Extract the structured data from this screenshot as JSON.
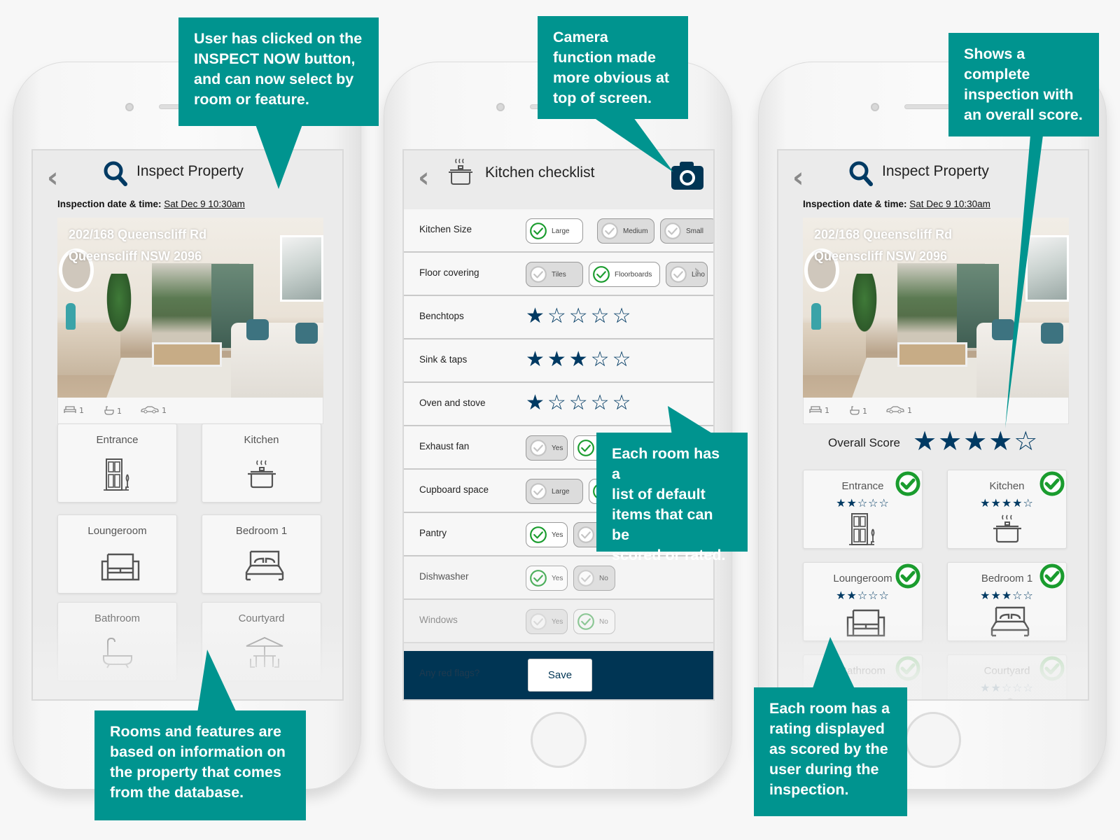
{
  "callouts": [
    "User has clicked on the\nINSPECT NOW button,\nand can now select by\nroom or feature.",
    "Camera\nfunction made\nmore obvious at\ntop of screen.",
    "Shows a\ncomplete\ninspection with\nan overall score.",
    "Each room has a\nlist of default\nitems that can be\nscored or rated.",
    "Rooms and features are\nbased on information on\nthe property that comes\nfrom the database.",
    "Each room has a\nrating displayed\nas scored by the\nuser during the\ninspection."
  ],
  "colors": {
    "callout": "#00948f",
    "navy": "#003a63",
    "footer": "#003554",
    "check_green": "#1a9c2e",
    "inspected_badge": "#17a23a"
  },
  "phone1": {
    "header": {
      "back_icon": "chevron-left-icon",
      "icon": "search-icon",
      "title": "Inspect Property"
    },
    "inspection": {
      "label": "Inspection date & time:",
      "value": "Sat Dec 9 10:30am"
    },
    "address": {
      "line1": "202/168 Queenscliff Rd",
      "line2": "Queenscliff NSW 2096"
    },
    "amenities": [
      {
        "icon": "bed-icon",
        "count": "1"
      },
      {
        "icon": "bath-icon",
        "count": "1"
      },
      {
        "icon": "car-icon",
        "count": "1"
      }
    ],
    "rooms": [
      {
        "name": "Entrance",
        "icon": "door"
      },
      {
        "name": "Kitchen",
        "icon": "pot"
      },
      {
        "name": "Loungeroom",
        "icon": "sofa"
      },
      {
        "name": "Bedroom 1",
        "icon": "bed"
      },
      {
        "name": "Bathroom",
        "icon": "bath"
      },
      {
        "name": "Courtyard",
        "icon": "umbrella"
      }
    ]
  },
  "phone2": {
    "header": {
      "back_icon": "chevron-left-icon",
      "icon": "pot-icon",
      "title": "Kitchen checklist",
      "camera_icon": "camera-icon"
    },
    "items": [
      {
        "label": "Kitchen Size",
        "type": "options",
        "options": [
          {
            "label": "Large",
            "selected": true
          },
          {
            "label": "Medium",
            "selected": false
          },
          {
            "label": "Small",
            "selected": false
          }
        ]
      },
      {
        "label": "Floor covering",
        "type": "options",
        "more": true,
        "options": [
          {
            "label": "Tiles",
            "selected": false
          },
          {
            "label": "Floorboards",
            "selected": true
          },
          {
            "label": "Lino",
            "selected": false
          }
        ]
      },
      {
        "label": "Benchtops",
        "type": "rating",
        "rating": 1
      },
      {
        "label": "Sink & taps",
        "type": "rating",
        "rating": 3
      },
      {
        "label": "Oven and stove",
        "type": "rating",
        "rating": 1
      },
      {
        "label": "Exhaust fan",
        "type": "options",
        "options": [
          {
            "label": "Yes",
            "selected": false
          },
          {
            "label": "",
            "selected": true
          }
        ]
      },
      {
        "label": "Cupboard space",
        "type": "options",
        "options": [
          {
            "label": "Large",
            "selected": false
          },
          {
            "label": "",
            "selected": true
          }
        ]
      },
      {
        "label": "Pantry",
        "type": "options",
        "options": [
          {
            "label": "Yes",
            "selected": true
          },
          {
            "label": "",
            "selected": false
          }
        ]
      },
      {
        "label": "Dishwasher",
        "type": "options",
        "options": [
          {
            "label": "Yes",
            "selected": true
          },
          {
            "label": "No",
            "selected": false
          }
        ]
      },
      {
        "label": "Windows",
        "type": "options",
        "options": [
          {
            "label": "Yes",
            "selected": false
          },
          {
            "label": "No",
            "selected": true
          }
        ]
      }
    ],
    "footer": {
      "red_flags": "Any red flags?",
      "save": "Save"
    }
  },
  "phone3": {
    "header": {
      "back_icon": "chevron-left-icon",
      "icon": "search-icon",
      "title": "Inspect Property"
    },
    "inspection": {
      "label": "Inspection date & time:",
      "value": "Sat Dec 9 10:30am"
    },
    "address": {
      "line1": "202/168 Queenscliff Rd",
      "line2": "Queenscliff NSW 2096"
    },
    "badge": "Inspected",
    "amenities": [
      {
        "icon": "bed-icon",
        "count": "1"
      },
      {
        "icon": "bath-icon",
        "count": "1"
      },
      {
        "icon": "car-icon",
        "count": "1"
      }
    ],
    "overall": {
      "label": "Overall Score",
      "rating": 4,
      "max": 5
    },
    "rooms": [
      {
        "name": "Entrance",
        "icon": "door",
        "rating": 2,
        "inspected": true
      },
      {
        "name": "Kitchen",
        "icon": "pot",
        "rating": 4,
        "inspected": true
      },
      {
        "name": "Loungeroom",
        "icon": "sofa",
        "rating": 2,
        "inspected": true
      },
      {
        "name": "Bedroom 1",
        "icon": "bed",
        "rating": 3,
        "inspected": true
      },
      {
        "name": "Bathroom",
        "icon": "bath",
        "inspected": true
      },
      {
        "name": "Courtyard",
        "icon": "umbrella",
        "rating": 2,
        "inspected": true
      }
    ]
  }
}
